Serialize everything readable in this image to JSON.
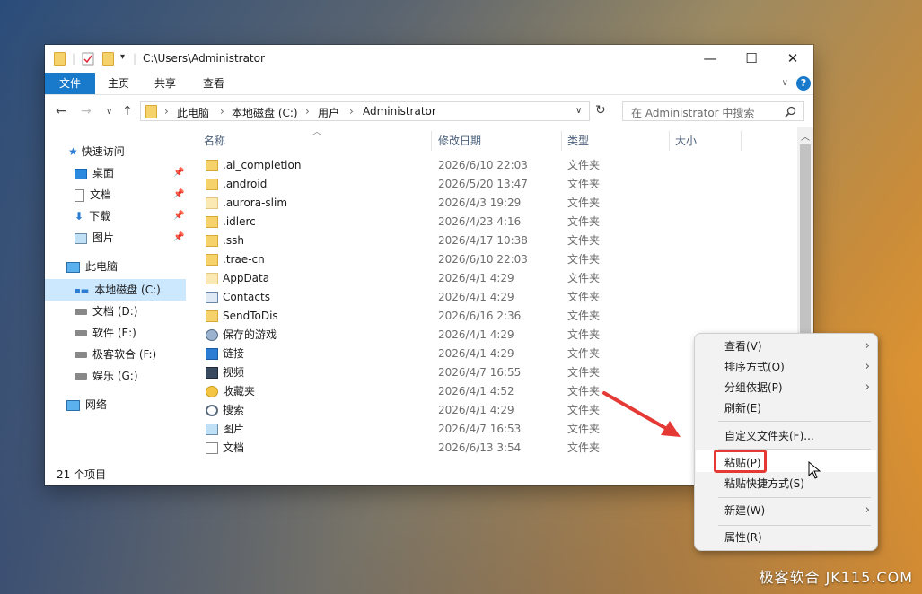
{
  "window": {
    "title": "C:\\Users\\Administrator",
    "controls": {
      "minimize": "—",
      "maximize": "☐",
      "close": "✕"
    }
  },
  "ribbon": {
    "tabs": [
      "文件",
      "主页",
      "共享",
      "查看"
    ]
  },
  "address": {
    "crumbs": [
      "此电脑",
      "本地磁盘 (C:)",
      "用户",
      "Administrator"
    ],
    "search_placeholder": "在 Administrator 中搜索"
  },
  "nav": {
    "quick_access": "快速访问",
    "pinned": [
      {
        "label": "桌面",
        "icon": "desktop-icon"
      },
      {
        "label": "文档",
        "icon": "document-icon"
      },
      {
        "label": "下载",
        "icon": "download-icon"
      },
      {
        "label": "图片",
        "icon": "picture-icon"
      }
    ],
    "this_pc": "此电脑",
    "drives": [
      "本地磁盘 (C:)",
      "文档 (D:)",
      "软件 (E:)",
      "极客软合 (F:)",
      "娱乐 (G:)"
    ],
    "network": "网络"
  },
  "columns": {
    "name": "名称",
    "date": "修改日期",
    "type": "类型",
    "size": "大小"
  },
  "files": [
    {
      "name": ".ai_completion",
      "date": "2026/6/10 22:03",
      "type": "文件夹",
      "icon": "folder-icon"
    },
    {
      "name": ".android",
      "date": "2026/5/20 13:47",
      "type": "文件夹",
      "icon": "folder-icon"
    },
    {
      "name": ".aurora-slim",
      "date": "2026/4/3 19:29",
      "type": "文件夹",
      "icon": "folder-faded-icon"
    },
    {
      "name": ".idlerc",
      "date": "2026/4/23 4:16",
      "type": "文件夹",
      "icon": "folder-icon"
    },
    {
      "name": ".ssh",
      "date": "2026/4/17 10:38",
      "type": "文件夹",
      "icon": "folder-icon"
    },
    {
      "name": ".trae-cn",
      "date": "2026/6/10 22:03",
      "type": "文件夹",
      "icon": "folder-icon"
    },
    {
      "name": "AppData",
      "date": "2026/4/1 4:29",
      "type": "文件夹",
      "icon": "folder-faded-icon"
    },
    {
      "name": "Contacts",
      "date": "2026/4/1 4:29",
      "type": "文件夹",
      "icon": "contacts-icon"
    },
    {
      "name": "SendToDis",
      "date": "2026/6/16 2:36",
      "type": "文件夹",
      "icon": "folder-icon"
    },
    {
      "name": "保存的游戏",
      "date": "2026/4/1 4:29",
      "type": "文件夹",
      "icon": "saved-games-icon"
    },
    {
      "name": "链接",
      "date": "2026/4/1 4:29",
      "type": "文件夹",
      "icon": "links-icon"
    },
    {
      "name": "视频",
      "date": "2026/4/7 16:55",
      "type": "文件夹",
      "icon": "video-icon"
    },
    {
      "name": "收藏夹",
      "date": "2026/4/1 4:52",
      "type": "文件夹",
      "icon": "favorites-icon"
    },
    {
      "name": "搜索",
      "date": "2026/4/1 4:29",
      "type": "文件夹",
      "icon": "search-icon"
    },
    {
      "name": "图片",
      "date": "2026/4/7 16:53",
      "type": "文件夹",
      "icon": "picture-icon"
    },
    {
      "name": "文档",
      "date": "2026/6/13 3:54",
      "type": "文件夹",
      "icon": "document-icon"
    }
  ],
  "status": "21 个项目",
  "context_menu": [
    {
      "label": "查看(V)",
      "submenu": true
    },
    {
      "label": "排序方式(O)",
      "submenu": true
    },
    {
      "label": "分组依据(P)",
      "submenu": true
    },
    {
      "label": "刷新(E)",
      "submenu": false
    },
    {
      "label": "自定义文件夹(F)...",
      "submenu": false
    },
    {
      "label": "粘贴(P)",
      "submenu": false,
      "highlighted": true
    },
    {
      "label": "粘贴快捷方式(S)",
      "submenu": false
    },
    {
      "label": "新建(W)",
      "submenu": true
    },
    {
      "label": "属性(R)",
      "submenu": false
    }
  ],
  "watermark": "极客软合 JK115.COM",
  "colors": {
    "accent": "#1979ca",
    "selection": "#cce8ff",
    "annotation": "#e53935"
  }
}
